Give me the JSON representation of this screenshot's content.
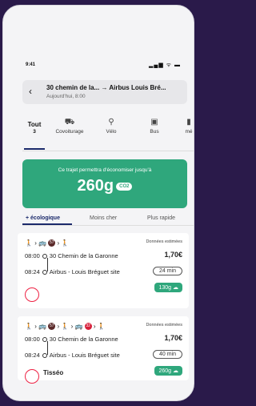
{
  "status": {
    "time": "9:41",
    "signal": "▂▄▆ ᯤ ▬"
  },
  "route": {
    "back": "‹",
    "title": "30 chemin de la... → Airbus Louis Bré...",
    "subtitle": "Aujourd'hui, 8:00"
  },
  "tabs": [
    {
      "label": "3",
      "icon": "Tout",
      "name": "all"
    },
    {
      "label": "Covoiturage",
      "icon": "carpool-icon"
    },
    {
      "label": "Vélo",
      "icon": "bike-icon"
    },
    {
      "label": "Bus",
      "icon": "bus-icon"
    },
    {
      "label": "mé",
      "icon": "metro-icon"
    }
  ],
  "banner": {
    "message": "Ce trajet permettra d'économiser jusqu'à",
    "amount": "260g",
    "unit": "CO2"
  },
  "sorts": {
    "eco": "+ écologique",
    "cheap": "Moins cher",
    "fast": "Plus rapide"
  },
  "cards": [
    {
      "modes": "🚶 › 🚌 57 › 🚶",
      "estimate": "Données estimées",
      "price": "1,70€",
      "dep_time": "08:00",
      "dep_place": "30 Chemin de la Garonne",
      "arr_time": "08:24",
      "arr_place": "Airbus - Louis Bréguet site",
      "duration": "24 min",
      "co2": "130g ☁"
    },
    {
      "modes": "🚶 › 🚌 57 › 🚶 › 🚌 32 › 🚶",
      "estimate": "Données estimées",
      "price": "1,70€",
      "dep_time": "08:00",
      "dep_place": "30 Chemin de la Garonne",
      "arr_time": "08:24",
      "arr_place": "Airbus - Louis Bréguet site",
      "duration": "40 min",
      "co2": "260g ☁",
      "operator": "Tisséo"
    }
  ]
}
